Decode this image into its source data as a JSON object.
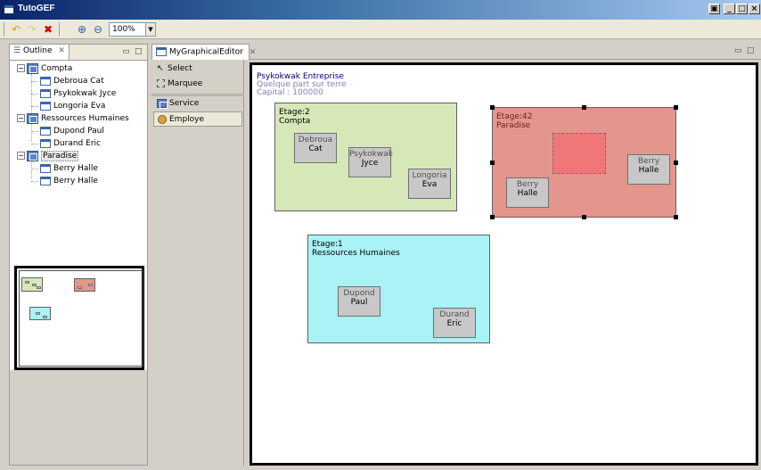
{
  "window": {
    "title": "TutoGEF",
    "controls": [
      "restore",
      "minimize",
      "maximize",
      "close"
    ]
  },
  "toolbar": {
    "zoom_value": "100%",
    "buttons": [
      "undo-icon",
      "redo-icon",
      "delete-icon",
      "zoom-in-icon",
      "zoom-out-icon"
    ]
  },
  "outline": {
    "tab_label": "Outline",
    "tree": [
      {
        "label": "Compta",
        "type": "service",
        "children": [
          {
            "label": "Debroua Cat"
          },
          {
            "label": "Psykokwak Jyce"
          },
          {
            "label": "Longoria Eva"
          }
        ]
      },
      {
        "label": "Ressources Humaines",
        "type": "service",
        "children": [
          {
            "label": "Dupond Paul"
          },
          {
            "label": "Durand Eric"
          }
        ]
      },
      {
        "label": "Paradise",
        "type": "service",
        "selected": true,
        "children": [
          {
            "label": "Berry Halle"
          },
          {
            "label": "Berry Halle"
          }
        ]
      }
    ]
  },
  "editor": {
    "tab_label": "MyGraphicalEditor",
    "palette": [
      {
        "label": "Select",
        "icon": "arrow-icon"
      },
      {
        "label": "Marquee",
        "icon": "marquee-icon"
      },
      {
        "label": "Service",
        "icon": "service-icon"
      },
      {
        "label": "Employe",
        "icon": "employe-icon"
      }
    ],
    "entreprise": {
      "name": "Psykokwak Entreprise",
      "address": "Quelque part sur terre",
      "capital": "Capital : 100000"
    },
    "services": [
      {
        "etage": "Etage:2",
        "name": "Compta",
        "color": "#d6e8b8",
        "employes": [
          {
            "first": "Debroua",
            "last": "Cat"
          },
          {
            "first": "Psykokwak",
            "last": "Jyce"
          },
          {
            "first": "Longoria",
            "last": "Eva"
          }
        ]
      },
      {
        "etage": "Etage:42",
        "name": "Paradise",
        "color": "#e4958c",
        "employes": [
          {
            "first": "Berry",
            "last": "Halle"
          },
          {
            "first": "Berry",
            "last": "Halle"
          }
        ]
      },
      {
        "etage": "Etage:1",
        "name": "Ressources Humaines",
        "color": "#a9f2f5",
        "employes": [
          {
            "first": "Dupond",
            "last": "Paul"
          },
          {
            "first": "Durand",
            "last": "Eric"
          }
        ]
      }
    ]
  }
}
